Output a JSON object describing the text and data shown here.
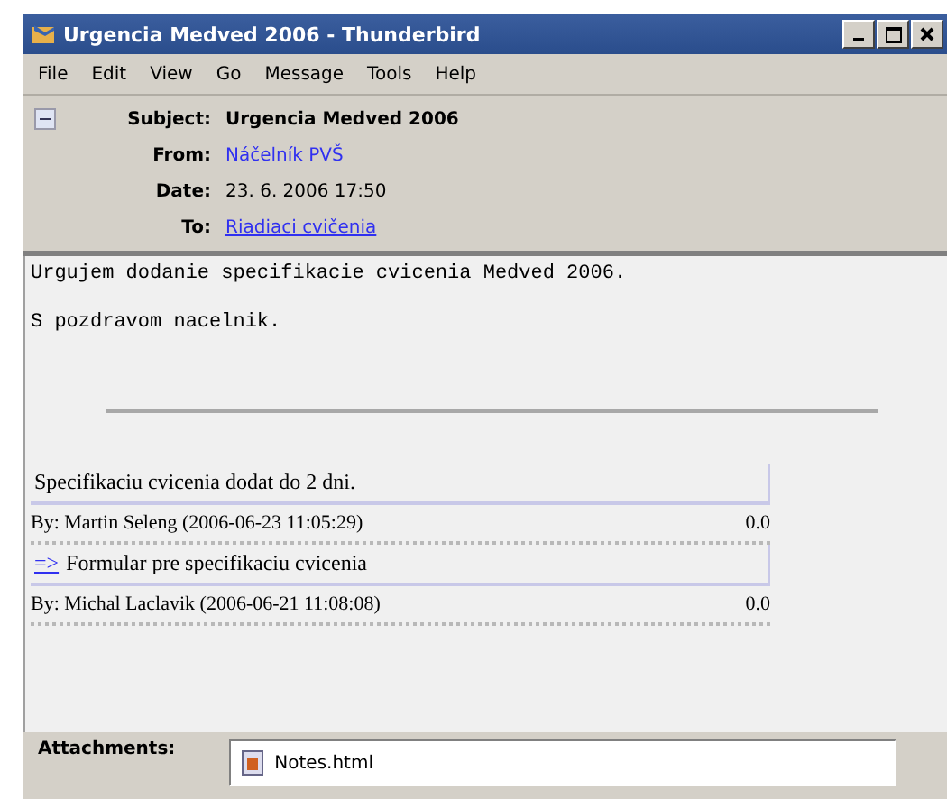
{
  "window": {
    "title": "Urgencia Medved 2006 - Thunderbird"
  },
  "menu": [
    "File",
    "Edit",
    "View",
    "Go",
    "Message",
    "Tools",
    "Help"
  ],
  "header": {
    "expanded": true,
    "fields": [
      {
        "label": "Subject:",
        "value": "Urgencia Medved 2006",
        "kind": "bold"
      },
      {
        "label": "From:",
        "value": "Náčelník PVŠ",
        "kind": "link"
      },
      {
        "label": "Date:",
        "value": "23. 6. 2006 17:50",
        "kind": "plain"
      },
      {
        "label": "To:",
        "value": "Riadiaci cvičenia",
        "kind": "underline"
      }
    ]
  },
  "body": [
    "Urgujem dodanie specifikacie cvicenia Medved 2006.",
    "S pozdravom nacelnik."
  ],
  "notes": [
    {
      "title": "Specifikaciu cvicenia dodat do 2 dni.",
      "byline": "By: Martin Seleng (2006-06-23 11:05:29)",
      "score": "0.0"
    },
    {
      "link": "=>",
      "title": "Formular pre specifikaciu cvicenia",
      "byline": "By: Michal Laclavik (2006-06-21 11:08:08)",
      "score": "0.0"
    }
  ],
  "attachments": {
    "label": "Attachments:",
    "files": [
      "Notes.html"
    ]
  }
}
